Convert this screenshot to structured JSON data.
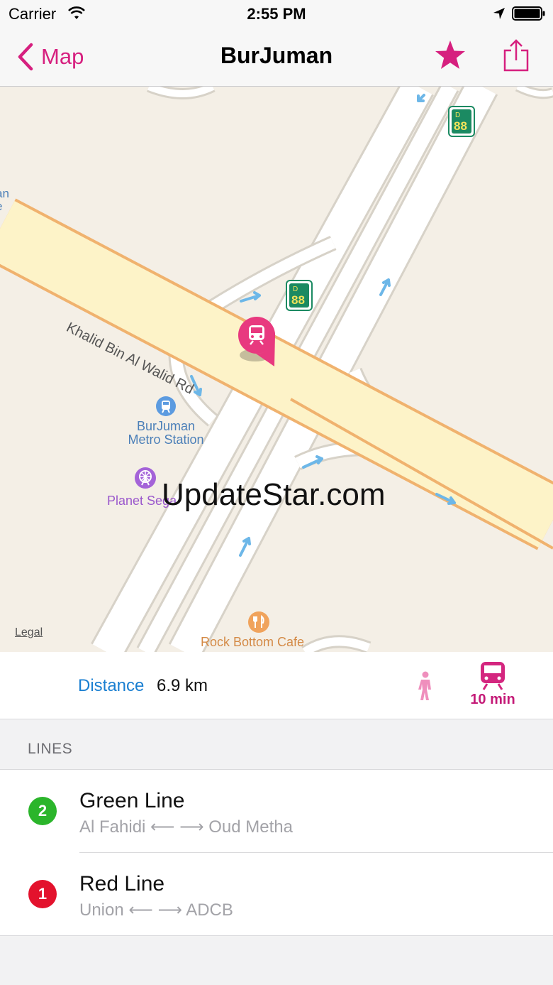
{
  "status_bar": {
    "carrier": "Carrier",
    "time": "2:55 PM"
  },
  "nav": {
    "back_label": "Map",
    "title": "BurJuman",
    "accent_color": "#d6207f"
  },
  "map": {
    "road_label": "Khalid Bin Al Walid Rd",
    "poi_metro_line1": "BurJuman",
    "poi_metro_line2": "Metro Station",
    "poi_sega": "Planet Sega",
    "poi_cafe": "Rock Bottom Cafe",
    "cut_label_line1": "an",
    "cut_label_line2": "e",
    "bus_stop_number": "88",
    "bus_stop_letter": "D",
    "legal": "Legal",
    "watermark": "UpdateStar.com"
  },
  "info": {
    "distance_label": "Distance",
    "distance_value": "6.9 km",
    "train_time": "10 min"
  },
  "lines_section": {
    "header": "LINES",
    "lines": [
      {
        "badge": "2",
        "name": "Green Line",
        "route": "Al Fahidi ⟵ ⟶ Oud Metha",
        "color": "#2bb52b"
      },
      {
        "badge": "1",
        "name": "Red Line",
        "route": "Union ⟵ ⟶ ADCB",
        "color": "#e3122d"
      }
    ]
  }
}
